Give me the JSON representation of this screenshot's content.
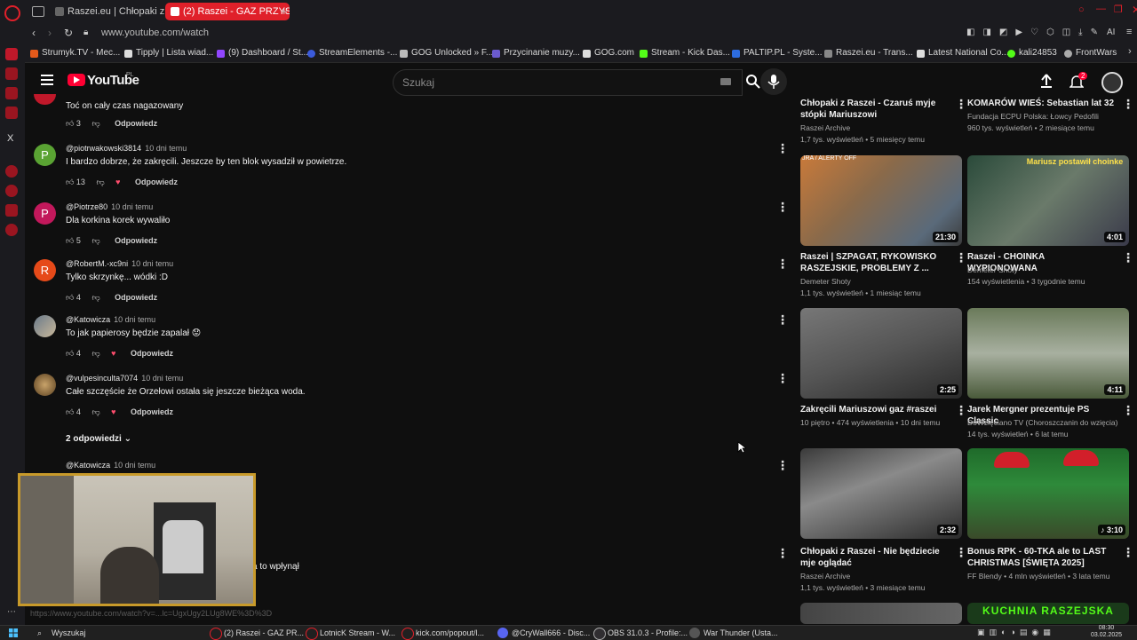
{
  "browser": {
    "tabs": [
      {
        "label": "Raszei.eu | Chłopaki z Ras"
      },
      {
        "label": "(2) Raszei - GAZ PRZYSZŁ"
      }
    ],
    "url": "www.youtube.com/watch",
    "bookmarks": [
      "Strumyk.TV - Mec...",
      "Tipply | Lista wiad...",
      "(9) Dashboard / St...",
      "StreamElements -...",
      "GOG Unlocked » F...",
      "Przycinanie muzy...",
      "GOG.com",
      "Stream - Kick Das...",
      "PALTIP.PL - Syste...",
      "Raszei.eu - Trans...",
      "Latest National Co...",
      "kali24853",
      "FrontWars"
    ]
  },
  "youtube": {
    "logo": "YouTube",
    "region": "PL",
    "search_placeholder": "Szukaj",
    "notifications_count": "2"
  },
  "comments": {
    "items": [
      {
        "author": "",
        "time": "",
        "text": "Toć on cały czas nagazowany",
        "likes": "3",
        "reply": "Odpowiedz"
      },
      {
        "author": "@piotrwakowski3814",
        "time": "10 dni temu",
        "text": "I bardzo dobrze, że zakręcili. Jeszcze by ten blok wysadził w powietrze.",
        "likes": "13",
        "reply": "Odpowiedz",
        "avatar": "P"
      },
      {
        "author": "@Piotrze80",
        "time": "10 dni temu",
        "text": "Dla korkina korek wywaliło",
        "likes": "5",
        "reply": "Odpowiedz",
        "avatar": "P"
      },
      {
        "author": "@RobertM.-xc9ni",
        "time": "10 dni temu",
        "text": "Tylko skrzynkę... wódki :D",
        "likes": "4",
        "reply": "Odpowiedz",
        "avatar": "R"
      },
      {
        "author": "@Katowicza",
        "time": "10 dni temu",
        "text": "To jak papierosy będzie zapalał 😟",
        "likes": "4",
        "reply": "Odpowiedz"
      },
      {
        "author": "@vulpesinculta7074",
        "time": "10 dni temu",
        "text": "Całe szczęście że Orzełowi ostała się jeszcze bieżąca woda.",
        "likes": "4",
        "reply": "Odpowiedz"
      },
      {
        "author": "@Katowicza",
        "time": "10 dni temu"
      }
    ],
    "replies_toggle": "2 odpowiedzi",
    "partial_text": "a to wpłynął",
    "status_url": "https://www.youtube.com/watch?v=...lc=UgxUgy2LUg8WE%3D%3D"
  },
  "sidebar": {
    "videos": [
      {
        "title": "Chłopaki z Raszei - Czaruś myje stópki Mariuszowi",
        "channel": "Raszei Archive",
        "meta": "1,7 tys. wyświetleń • 5 miesięcy temu"
      },
      {
        "title": "KOMARÓW WIEŚ: Sebastian lat 32",
        "channel": "Fundacja ECPU Polska: Łowcy Pedofili",
        "meta": "960 tys. wyświetleń • 2 miesiące temu"
      },
      {
        "title": "Raszei | SZPAGAT, RYKOWISKO RASZEJSKIE, PROBLEMY Z ...",
        "channel": "Demeter Shoty",
        "meta": "1,1 tys. wyświetleń • 1 miesiąc temu",
        "duration": "21:30",
        "thumb_text": "JRA / ALERTY OFF"
      },
      {
        "title": "Raszei - CHOINKA WYPIONOWANA",
        "channel": "Demeter Shoty",
        "meta": "154 wyświetlenia • 3 tygodnie temu",
        "duration": "4:01",
        "thumb_text": "Mariusz postawił choinke"
      },
      {
        "title": "Zakręcili Mariuszowi gaz #raszei",
        "channel": "10 piętro",
        "meta": "474 wyświetlenia • 10 dni temu",
        "duration": "2:25"
      },
      {
        "title": "Jarek Mergner prezentuje PS Classic",
        "channel": "DoWzięciano TV (Choroszczanin do wzięcia)",
        "meta": "14 tys. wyświetleń • 6 lat temu",
        "duration": "4:11"
      },
      {
        "title": "Chłopaki z Raszei - Nie będziecie mje oglądać",
        "channel": "Raszei Archive",
        "meta": "1,1 tys. wyświetleń • 3 miesiące temu",
        "duration": "2:32"
      },
      {
        "title": "Bonus RPK - 60-TKA ale to LAST CHRISTMAS [ŚWIĘTA 2025]",
        "channel": "FF Blendy",
        "meta": "4 mln wyświetleń • 3 lata temu",
        "duration": "3:10"
      },
      {
        "thumb_text": "KUCHNIA RASZEJSKA"
      }
    ]
  },
  "taskbar": {
    "search": "Wyszukaj",
    "apps": [
      "(2) Raszei - GAZ PR...",
      "LotnicK Stream - W...",
      "kick.com/popout/l...",
      "@CryWall666 - Disc...",
      "OBS 31.0.3 - Profile:...",
      "War Thunder (Usta..."
    ],
    "clock_time": "08:30",
    "clock_date": "03.02.2025"
  },
  "colors": {
    "youtube_red": "#ff0033",
    "opera_red": "#e0202a",
    "bg": "#0f0f0f"
  }
}
